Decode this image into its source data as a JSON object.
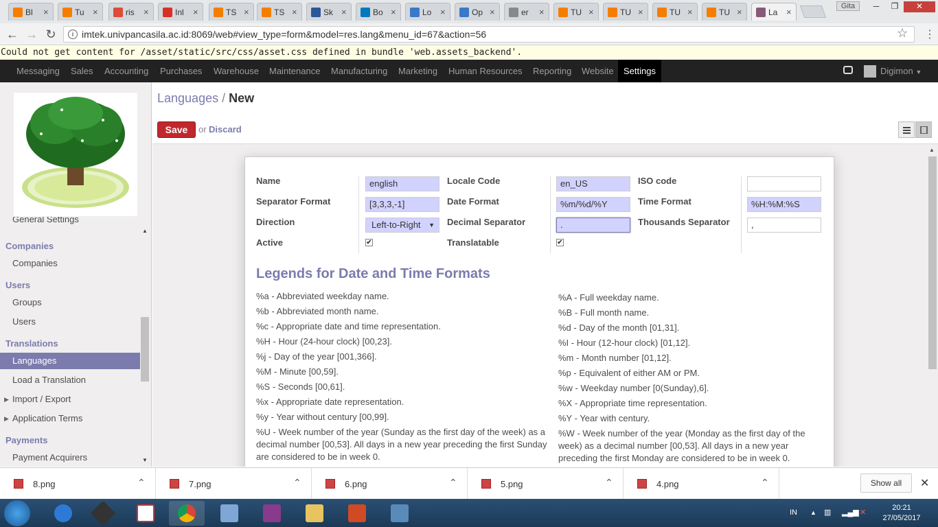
{
  "browser": {
    "tabs": [
      {
        "title": "Bl",
        "color": "#f57d00"
      },
      {
        "title": "Tu",
        "color": "#f57d00"
      },
      {
        "title": "ris",
        "color": "#dd4b39"
      },
      {
        "title": "Inl",
        "color": "#d93025"
      },
      {
        "title": "TS",
        "color": "#f57d00"
      },
      {
        "title": "TS",
        "color": "#f57d00"
      },
      {
        "title": "Sk",
        "color": "#2b579a"
      },
      {
        "title": "Bo",
        "color": "#0079bf"
      },
      {
        "title": "Lo",
        "color": "#3a78c9"
      },
      {
        "title": "Op",
        "color": "#3a78c9"
      },
      {
        "title": "er",
        "color": "#888888"
      },
      {
        "title": "TU",
        "color": "#f57d00"
      },
      {
        "title": "TU",
        "color": "#f57d00"
      },
      {
        "title": "TU",
        "color": "#f57d00"
      },
      {
        "title": "TU",
        "color": "#f57d00"
      },
      {
        "title": "La",
        "color": "#875a7b"
      }
    ],
    "profile": "Gita",
    "url": "imtek.univpancasila.ac.id:8069/web#view_type=form&model=res.lang&menu_id=67&action=56",
    "error_bar": "Could not get content for /asset/static/src/css/asset.css defined in bundle 'web.assets_backend'."
  },
  "topmenu": {
    "items": [
      "Messaging",
      "Sales",
      "Accounting",
      "Purchases",
      "Warehouse",
      "Maintenance",
      "Manufacturing",
      "Marketing",
      "Human Resources",
      "Reporting",
      "Website",
      "Settings"
    ],
    "active": "Settings",
    "user": "Digimon"
  },
  "sidebar": {
    "partial_item": "General Settings",
    "sections": [
      {
        "title": "Companies",
        "items": [
          "Companies"
        ]
      },
      {
        "title": "Users",
        "items": [
          "Groups",
          "Users"
        ]
      },
      {
        "title": "Translations",
        "items": [
          "Languages",
          "Load a Translation",
          "Import / Export",
          "Application Terms"
        ]
      },
      {
        "title": "Payments",
        "items": [
          "Payment Acquirers"
        ]
      }
    ],
    "active_item": "Languages"
  },
  "main": {
    "breadcrumb": {
      "parent": "Languages",
      "sep": "/",
      "current": "New"
    },
    "save_label": "Save",
    "or_label": "or",
    "discard_label": "Discard",
    "form": {
      "name_label": "Name",
      "name_value": "english",
      "locale_label": "Locale Code",
      "locale_value": "en_US",
      "iso_label": "ISO code",
      "iso_value": "",
      "sepfmt_label": "Separator Format",
      "sepfmt_value": "[3,3,3,-1]",
      "datefmt_label": "Date Format",
      "datefmt_value": "%m/%d/%Y",
      "timefmt_label": "Time Format",
      "timefmt_value": "%H:%M:%S",
      "direction_label": "Direction",
      "direction_value": "Left-to-Right",
      "decsep_label": "Decimal Separator",
      "decsep_value": ".",
      "thousep_label": "Thousands Separator",
      "thousep_value": ",",
      "active_label": "Active",
      "active_checked": true,
      "translatable_label": "Translatable",
      "translatable_checked": true
    },
    "legend_title": "Legends for Date and Time Formats",
    "legend_left": [
      "%a - Abbreviated weekday name.",
      "%b - Abbreviated month name.",
      "%c - Appropriate date and time representation.",
      "%H - Hour (24-hour clock) [00,23].",
      "%j - Day of the year [001,366].",
      "%M - Minute [00,59].",
      "%S - Seconds [00,61].",
      "%x - Appropriate date representation.",
      "%y - Year without century [00,99].",
      "%U - Week number of the year (Sunday as the first day of the week) as a decimal number [00,53]. All days in a new year preceding the first Sunday are considered to be in week 0."
    ],
    "legend_right": [
      "%A - Full weekday name.",
      "%B - Full month name.",
      "%d - Day of the month [01,31].",
      "%I - Hour (12-hour clock) [01,12].",
      "%m - Month number [01,12].",
      "%p - Equivalent of either AM or PM.",
      "%w - Weekday number [0(Sunday),6].",
      "%X - Appropriate time representation.",
      "%Y - Year with century.",
      "%W - Week number of the year (Monday as the first day of the week) as a decimal number [00,53]. All days in a new year preceding the first Monday are considered to be in week 0."
    ]
  },
  "downloads": {
    "files": [
      "8.png",
      "7.png",
      "6.png",
      "5.png",
      "4.png"
    ],
    "show_all": "Show all"
  },
  "taskbar": {
    "lang": "IN",
    "time": "20:21",
    "date": "27/05/2017"
  }
}
